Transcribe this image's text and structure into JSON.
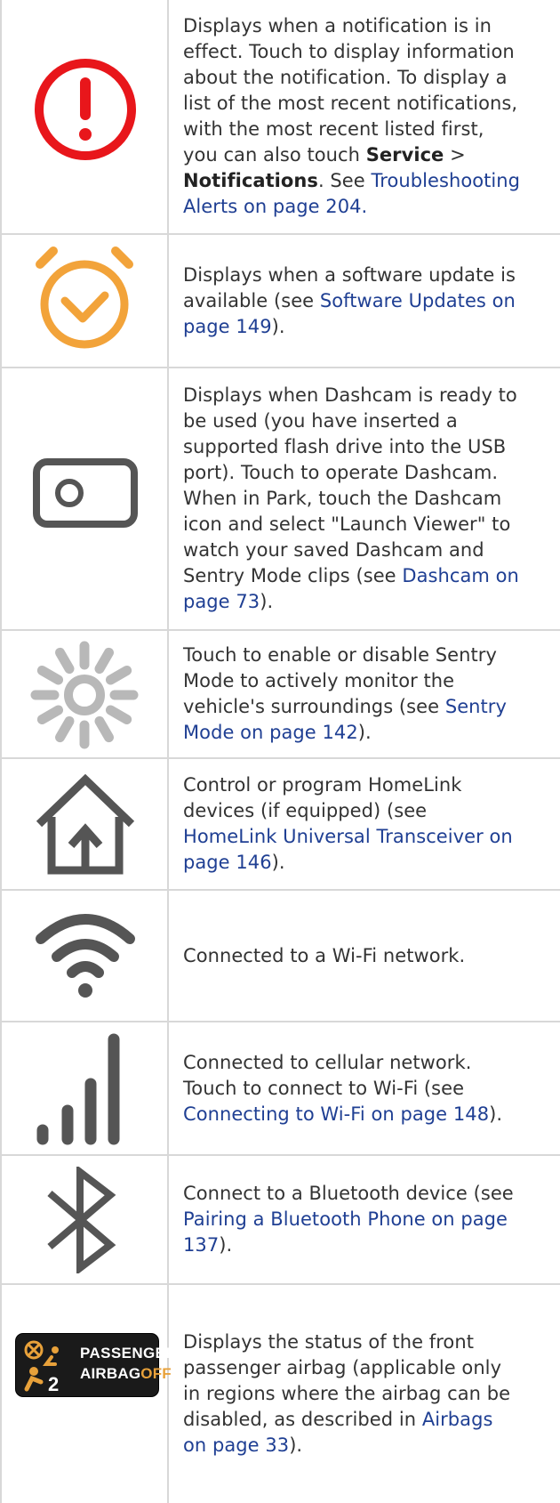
{
  "rows": [
    {
      "icon": "alert-circle-icon",
      "lines": [
        [
          {
            "t": "Displays when a notification is in"
          }
        ],
        [
          {
            "t": "effect. Touch to display information"
          }
        ],
        [
          {
            "t": "about the notification. To display a"
          }
        ],
        [
          {
            "t": "list of the most recent notifications,"
          }
        ],
        [
          {
            "t": "with the most recent listed first,"
          }
        ],
        [
          {
            "t": "you can also touch "
          },
          {
            "t": "Service",
            "s": "bold"
          },
          {
            "t": " >"
          }
        ],
        [
          {
            "t": "Notifications",
            "s": "bold"
          },
          {
            "t": ". See "
          },
          {
            "t": "Troubleshooting",
            "s": "link"
          }
        ],
        [
          {
            "t": "Alerts on page 204.",
            "s": "link"
          }
        ]
      ]
    },
    {
      "icon": "alarm-clock-icon",
      "lines": [
        [
          {
            "t": "Displays when a software update is"
          }
        ],
        [
          {
            "t": "available (see "
          },
          {
            "t": "Software Updates on",
            "s": "link"
          }
        ],
        [
          {
            "t": "page 149",
            "s": "link"
          },
          {
            "t": ")."
          }
        ]
      ]
    },
    {
      "icon": "dashcam-icon",
      "lines": [
        [
          {
            "t": "Displays when Dashcam is ready to"
          }
        ],
        [
          {
            "t": "be used (you have inserted a"
          }
        ],
        [
          {
            "t": "supported flash drive into the USB"
          }
        ],
        [
          {
            "t": "port). Touch to operate Dashcam."
          }
        ],
        [
          {
            "t": "When in Park, touch the Dashcam"
          }
        ],
        [
          {
            "t": "icon and select \"Launch Viewer\" to"
          }
        ],
        [
          {
            "t": "watch your saved Dashcam and"
          }
        ],
        [
          {
            "t": "Sentry Mode clips (see "
          },
          {
            "t": "Dashcam on",
            "s": "link"
          }
        ],
        [
          {
            "t": "page 73",
            "s": "link"
          },
          {
            "t": ")."
          }
        ]
      ]
    },
    {
      "icon": "sentry-mode-icon",
      "lines": [
        [
          {
            "t": "Touch to enable or disable Sentry"
          }
        ],
        [
          {
            "t": "Mode to actively monitor the"
          }
        ],
        [
          {
            "t": "vehicle's surroundings (see "
          },
          {
            "t": "Sentry",
            "s": "link"
          }
        ],
        [
          {
            "t": "Mode on page 142",
            "s": "link"
          },
          {
            "t": ")."
          }
        ]
      ]
    },
    {
      "icon": "homelink-icon",
      "lines": [
        [
          {
            "t": "Control or program HomeLink"
          }
        ],
        [
          {
            "t": "devices (if equipped) (see"
          }
        ],
        [
          {
            "t": "HomeLink Universal Transceiver on",
            "s": "link"
          }
        ],
        [
          {
            "t": "page 146",
            "s": "link"
          },
          {
            "t": ")."
          }
        ]
      ]
    },
    {
      "icon": "wifi-icon",
      "lines": [
        [
          {
            "t": "Connected to a Wi-Fi network."
          }
        ]
      ]
    },
    {
      "icon": "cellular-signal-icon",
      "lines": [
        [
          {
            "t": "Connected to cellular network."
          }
        ],
        [
          {
            "t": "Touch to connect to Wi-Fi (see"
          }
        ],
        [
          {
            "t": "Connecting to Wi-Fi on page 148",
            "s": "link"
          },
          {
            "t": ")."
          }
        ]
      ]
    },
    {
      "icon": "bluetooth-icon",
      "lines": [
        [
          {
            "t": "Connect to a Bluetooth device (see"
          }
        ],
        [
          {
            "t": "Pairing a Bluetooth Phone on page",
            "s": "link"
          }
        ],
        [
          {
            "t": "137",
            "s": "link"
          },
          {
            "t": ")."
          }
        ]
      ]
    },
    {
      "icon": "passenger-airbag-off-icon",
      "badge": {
        "line1": "PASSENGER",
        "line2a": "AIRBAG",
        "line2b": "OFF",
        "num": "2"
      },
      "lines": [
        [
          {
            "t": "Displays the status of the front"
          }
        ],
        [
          {
            "t": "passenger airbag (applicable only"
          }
        ],
        [
          {
            "t": "in regions where the airbag can be"
          }
        ],
        [
          {
            "t": "disabled, as described in "
          },
          {
            "t": "Airbags",
            "s": "link"
          }
        ],
        [
          {
            "t": "on page 33",
            "s": "link"
          },
          {
            "t": ")."
          }
        ]
      ]
    }
  ],
  "colors": {
    "alert": "#e8161b",
    "clock": "#f2a33a",
    "icon_gray": "#555555",
    "link": "#1f3f93",
    "airbag_off": "#e8a13a"
  }
}
